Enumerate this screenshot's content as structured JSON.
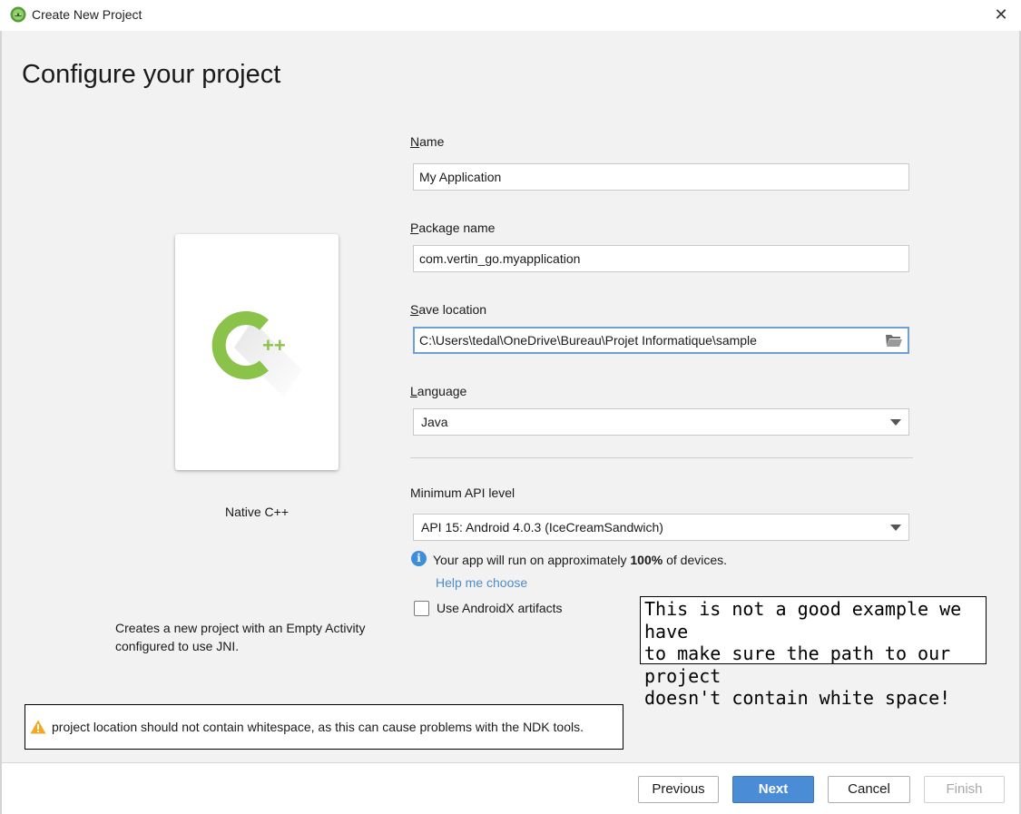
{
  "window": {
    "title": "Create New Project",
    "close_glyph": "✕"
  },
  "page": {
    "heading": "Configure your project"
  },
  "template": {
    "name": "Native C++",
    "description": "Creates a new project with an Empty Activity configured to use JNI.",
    "icon": "cpp-logo-icon",
    "logo_text": "C++",
    "accent_color": "#8bc34a"
  },
  "form": {
    "name_label_mnemonic": "N",
    "name_label_rest": "ame",
    "name_value": "My Application",
    "package_label_mnemonic": "P",
    "package_label_rest": "ackage name",
    "package_value": "com.vertin_go.myapplication",
    "save_label_mnemonic": "S",
    "save_label_rest": "ave location",
    "save_value": "C:\\Users\\tedal\\OneDrive\\Bureau\\Projet Informatique\\sample",
    "language_label_mnemonic": "L",
    "language_label_rest": "anguage",
    "language_value": "Java",
    "min_api_label": "Minimum API level",
    "min_api_value": "API 15: Android 4.0.3 (IceCreamSandwich)",
    "info_prefix": "Your app will run on approximately ",
    "info_percent": "100%",
    "info_suffix": " of devices.",
    "help_link": "Help me choose",
    "androidx_label": "Use AndroidX artifacts",
    "androidx_checked": false
  },
  "annotation": {
    "text": "This is not a good example we have\nto make sure the path to our project\ndoesn't contain white space!"
  },
  "warning": {
    "text": "project location should not contain whitespace, as this can cause problems with the NDK tools.",
    "icon": "warning-icon",
    "icon_color": "#f5a623"
  },
  "buttons": {
    "previous": "Previous",
    "next": "Next",
    "cancel": "Cancel",
    "finish": "Finish"
  },
  "colors": {
    "primary_button": "#4b8cd6",
    "link": "#4f8cc9",
    "info_icon": "#3c8ed8",
    "focus_border": "#6ea0d6"
  }
}
